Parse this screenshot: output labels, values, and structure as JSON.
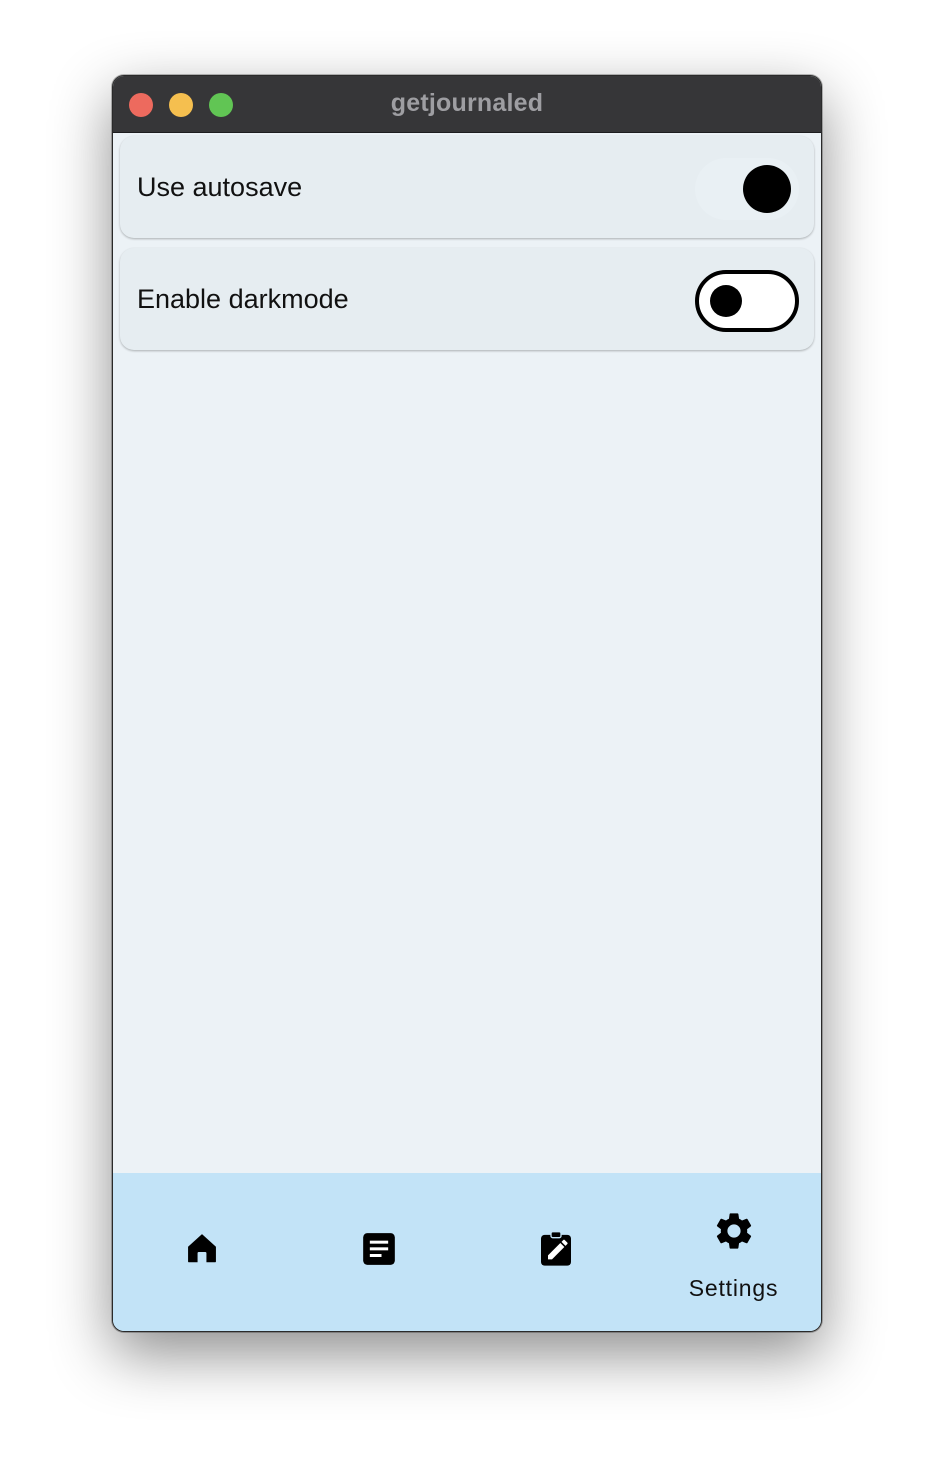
{
  "window": {
    "title": "getjournaled"
  },
  "settings": [
    {
      "label": "Use autosave",
      "enabled": true
    },
    {
      "label": "Enable darkmode",
      "enabled": false
    }
  ],
  "nav": {
    "items": [
      {
        "icon": "home-icon",
        "label": ""
      },
      {
        "icon": "article-icon",
        "label": ""
      },
      {
        "icon": "edit-clipboard-icon",
        "label": ""
      },
      {
        "icon": "gear-icon",
        "label": "Settings",
        "selected": true
      }
    ]
  },
  "colors": {
    "titlebar": "#363638",
    "content_background": "#ecf2f6",
    "card_background": "#e6edf1",
    "nav_background": "#c2e3f7",
    "close": "#ed6a5e",
    "minimize": "#f5bf4f",
    "zoom": "#61c554"
  }
}
